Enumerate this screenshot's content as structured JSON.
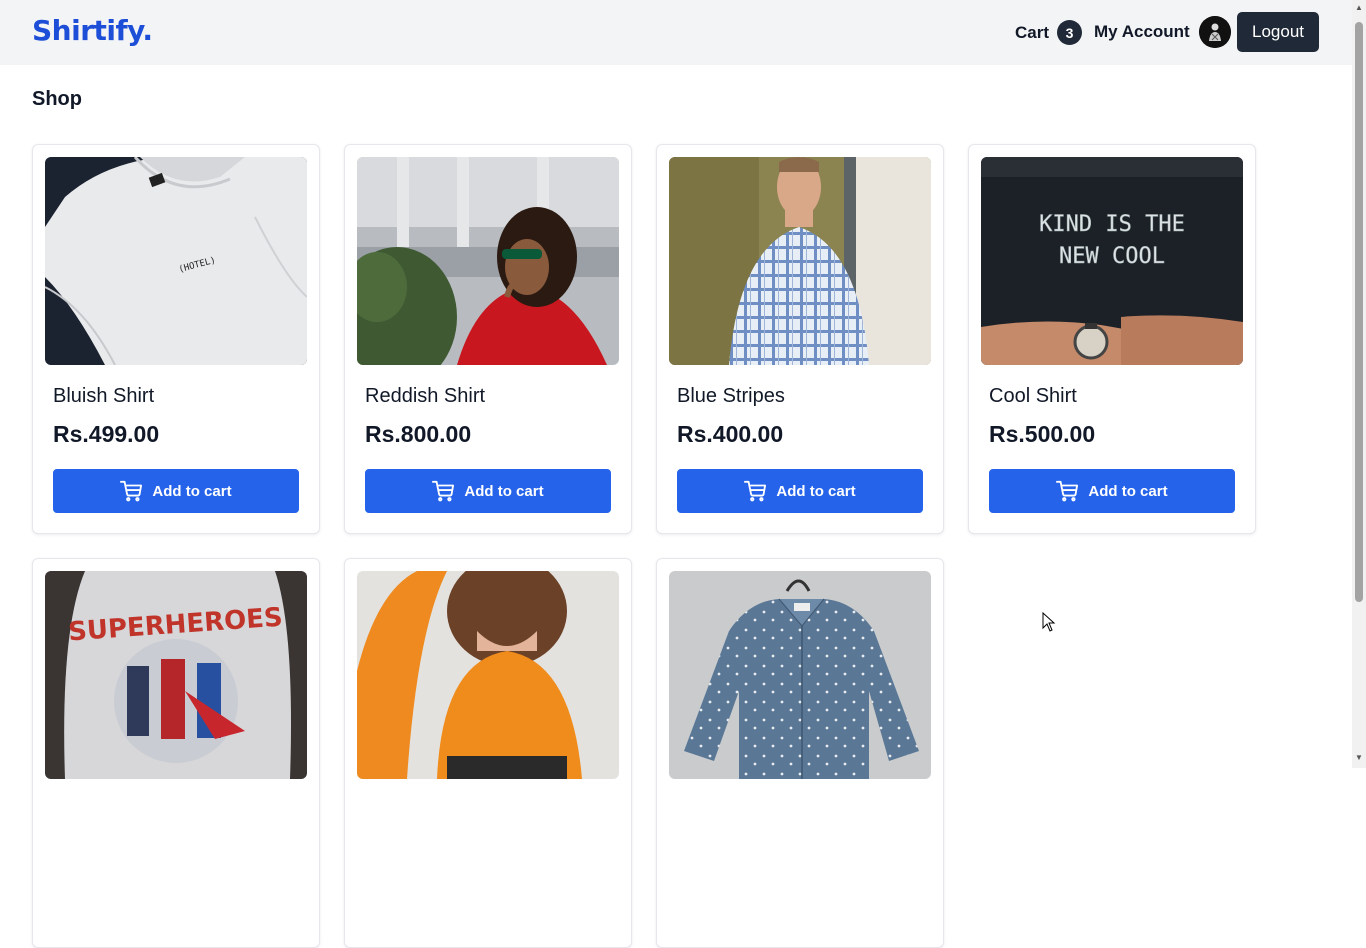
{
  "header": {
    "logo": "Shirtify.",
    "cart_label": "Cart",
    "cart_count": "3",
    "account_label": "My Account",
    "logout_label": "Logout"
  },
  "page": {
    "title": "Shop"
  },
  "products": [
    {
      "name": "Bluish Shirt",
      "price": "Rs.499.00",
      "button": "Add to cart"
    },
    {
      "name": "Reddish Shirt",
      "price": "Rs.800.00",
      "button": "Add to cart"
    },
    {
      "name": "Blue Stripes",
      "price": "Rs.400.00",
      "button": "Add to cart"
    },
    {
      "name": "Cool Shirt",
      "price": "Rs.500.00",
      "button": "Add to cart"
    },
    {
      "image_text": "SUPERHEROES"
    },
    {},
    {}
  ],
  "image_texts": {
    "hotel_tag": "(HOTEL)",
    "cool_line1": "KIND IS THE",
    "cool_line2": "NEW COOL"
  },
  "colors": {
    "brand": "#1d4ed8",
    "button": "#2563eb",
    "dark": "#1f2937",
    "header_bg": "#f3f4f6"
  }
}
